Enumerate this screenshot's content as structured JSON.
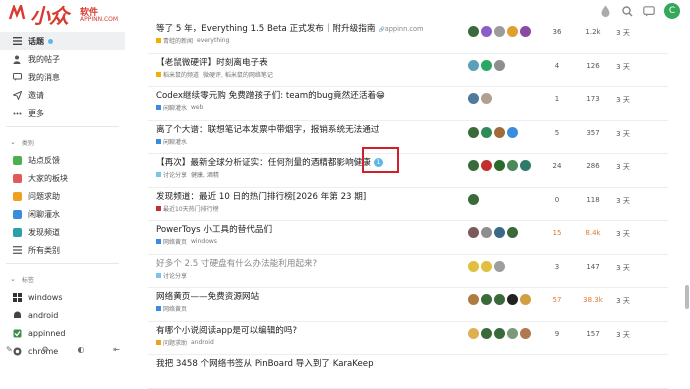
{
  "header": {
    "logo_text": "小众",
    "logo_cn": "软件",
    "logo_domain": "APPINN.COM",
    "avatar_letter": "C",
    "icons": [
      "theme-icon",
      "search-icon",
      "chat-icon",
      "user-avatar"
    ]
  },
  "sidebar": {
    "items": [
      {
        "label": "话题",
        "icon": "topics-icon",
        "active": true
      },
      {
        "label": "我的帖子",
        "icon": "user-icon"
      },
      {
        "label": "我的消息",
        "icon": "message-icon"
      },
      {
        "label": "邀请",
        "icon": "invite-icon"
      },
      {
        "label": "更多",
        "icon": "more-icon"
      }
    ],
    "categories_title": "类别",
    "categories": [
      {
        "label": "站点反馈",
        "color": "#4caf50"
      },
      {
        "label": "大家的板块",
        "color": "#e05a5a"
      },
      {
        "label": "问题求助",
        "color": "#f0a020"
      },
      {
        "label": "闲聊灌水",
        "color": "#3a8dde"
      },
      {
        "label": "发现频道",
        "color": "#2aa1a6"
      },
      {
        "label": "所有类别",
        "color": "#666666"
      }
    ],
    "tags_title": "标签",
    "tags": [
      {
        "label": "windows",
        "color": "#333333"
      },
      {
        "label": "android",
        "color": "#444444"
      },
      {
        "label": "appinned",
        "color": "#3b8f4a"
      },
      {
        "label": "chrome",
        "color": "#555555"
      }
    ]
  },
  "topics": [
    {
      "title": "等了 5 年，Everything 1.5 Beta 正式发布｜附升级指南",
      "link": "appinn.com",
      "cat": "青蛙的新闻",
      "cat_color": "#f0b000",
      "tags": "everything",
      "replies": "36",
      "views": "1.2k",
      "activity": "3 天",
      "avatars": [
        "#3a6a3a",
        "#8e5ec7",
        "#9b9b9b",
        "#e0a030",
        "#8c4ba3"
      ]
    },
    {
      "title": "【老鼠微硬评】时刻离电子表",
      "link": "",
      "cat": "稻米鼠的频道",
      "cat_color": "#f0b000",
      "tags": "微硬评, 稻米鼠的网络笔记",
      "replies": "4",
      "views": "126",
      "activity": "3 天",
      "avatars": [
        "#5aa0b8",
        "#28a862",
        "#8e8e8e"
      ]
    },
    {
      "title": "Codex继续零元购 免费蹭孩子们: team的bug竟然还活着😁",
      "link": "",
      "cat": "闲聊灌水",
      "cat_color": "#3a8dde",
      "tags": "web",
      "replies": "1",
      "views": "173",
      "activity": "3 天",
      "avatars": [
        "#4e7a9c",
        "#b0a090"
      ]
    },
    {
      "title": "离了个大谱：联想笔记本发票中带烟字，报销系统无法通过",
      "link": "",
      "cat": "闲聊灌水",
      "cat_color": "#3a8dde",
      "tags": "",
      "replies": "5",
      "views": "357",
      "activity": "3 天",
      "avatars": [
        "#3a6a3a",
        "#2f8a5a",
        "#a06a3a",
        "#3a8dde"
      ]
    },
    {
      "title": "【再次】最新全球分析证实：任何剂量的酒精都影响健康",
      "link": "",
      "badge": "1",
      "cat": "讨论分享",
      "cat_color": "#7ec3e8",
      "tags": "健康, 酒精",
      "replies": "24",
      "views": "286",
      "activity": "3 天",
      "avatars": [
        "#3a6a3a",
        "#c03030",
        "#2a6a2a",
        "#4a8a5a",
        "#2f7a6a"
      ]
    },
    {
      "title": "发现频道：最近 10 日的热门排行榜[2026 年第 23 期]",
      "link": "",
      "cat": "最近10天热门排行榜",
      "cat_color": "#c03030",
      "tags": "",
      "replies": "0",
      "views": "118",
      "activity": "3 天",
      "avatars": [
        "#3a6a3a"
      ]
    },
    {
      "title": "PowerToys 小工具的替代品们",
      "link": "",
      "cat": "网络黄页",
      "cat_color": "#3a8dde",
      "tags": "windows",
      "replies": "15",
      "views": "8.4k",
      "activity": "3 天",
      "hot": true,
      "avatars": [
        "#7a5a5a",
        "#8e8e8e",
        "#3a6a8a",
        "#3a6a3a"
      ]
    },
    {
      "title": "好多个 2.5 寸硬盘有什么办法能利用起来?",
      "link": "",
      "read": true,
      "cat": "讨论分享",
      "cat_color": "#7ec3e8",
      "tags": "",
      "replies": "3",
      "views": "147",
      "activity": "3 天",
      "avatars": [
        "#e0c040",
        "#e0c040",
        "#9e9e9e"
      ]
    },
    {
      "title": "网络黄页——免费资源网站",
      "link": "",
      "cat": "网络黄页",
      "cat_color": "#3a8dde",
      "tags": "",
      "replies": "57",
      "views": "38.3k",
      "activity": "3 天",
      "hot": true,
      "avatars": [
        "#b07a40",
        "#3a6a3a",
        "#3a6a3a",
        "#222222",
        "#d0a040"
      ]
    },
    {
      "title": "有哪个小说阅读app是可以编辑的吗?",
      "link": "",
      "cat": "问题求助",
      "cat_color": "#f0a020",
      "tags": "android",
      "replies": "9",
      "views": "157",
      "activity": "3 天",
      "avatars": [
        "#e0b050",
        "#3a6a3a",
        "#3a6a3a",
        "#7a9a7a",
        "#b07a50"
      ]
    },
    {
      "title": "我把 3458 个网络书签从 PinBoard 导入到了 KaraKeep",
      "link": "",
      "cat": "",
      "cat_color": "#3a8dde",
      "tags": "",
      "replies": "",
      "views": "",
      "activity": "",
      "avatars": []
    }
  ]
}
